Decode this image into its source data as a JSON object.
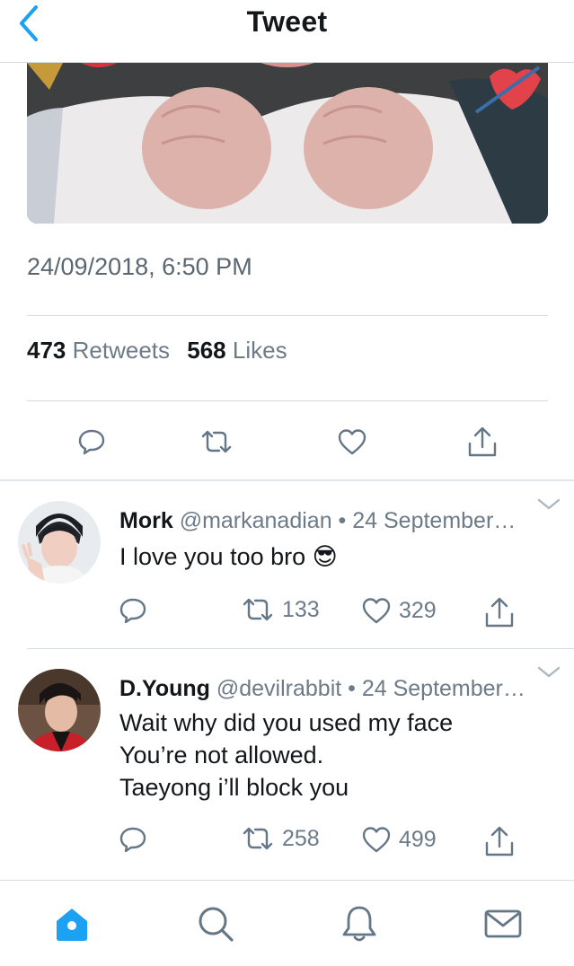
{
  "header": {
    "title": "Tweet"
  },
  "tweet": {
    "timestamp": "24/09/2018, 6:50 PM",
    "retweets_count": "473",
    "retweets_label": "Retweets",
    "likes_count": "568",
    "likes_label": "Likes"
  },
  "replies": [
    {
      "name": "Mork",
      "handle_date": "@markanadian • 24 September…",
      "lines": [
        "I love you too bro 😎"
      ],
      "retweets": "133",
      "likes": "329"
    },
    {
      "name": "D.Young",
      "handle_date": "@devilrabbit • 24 September…",
      "lines": [
        "Wait why did you used my face",
        "You’re not allowed.",
        "Taeyong i’ll block you"
      ],
      "retweets": "258",
      "likes": "499"
    }
  ],
  "colors": {
    "accent": "#1da1f2",
    "icon_gray": "#657786",
    "divider": "#d6dbdf",
    "text": "#14171a",
    "secondary_text": "#6d7b88"
  },
  "icons": {
    "back": "chevron-left-icon",
    "reply": "reply-icon",
    "retweet": "retweet-icon",
    "like": "heart-icon",
    "share": "share-icon",
    "more": "chevron-down-icon",
    "tab_home": "home-icon",
    "tab_search": "search-icon",
    "tab_notifications": "bell-icon",
    "tab_messages": "mail-icon"
  }
}
